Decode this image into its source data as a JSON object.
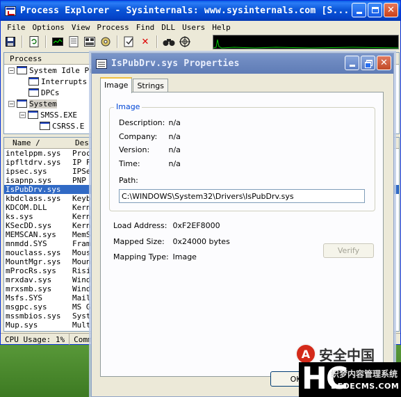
{
  "main_window": {
    "title": "Process Explorer - Sysinternals: www.sysinternals.com [S...",
    "menu": [
      "File",
      "Options",
      "View",
      "Process",
      "Find",
      "DLL",
      "Users",
      "Help"
    ],
    "toolbar_icons": [
      "save-icon",
      "refresh-icon",
      "system-info-icon",
      "properties-icon",
      "dll-view-icon",
      "gear-icon",
      "check-icon",
      "kill-icon",
      "find-icon",
      "target-icon"
    ],
    "tree_header": "Process",
    "tree_rows": [
      {
        "name": "System Idle Pro",
        "expander": "−",
        "indent": 0
      },
      {
        "name": "Interrupts",
        "expander": "",
        "indent": 1
      },
      {
        "name": "DPCs",
        "expander": "",
        "indent": 1
      },
      {
        "name": "System",
        "expander": "−",
        "indent": 0
      },
      {
        "name": "SMSS.EXE",
        "expander": "−",
        "indent": 1
      },
      {
        "name": "CSRSS.E",
        "expander": "",
        "indent": 2
      }
    ],
    "dll_headers": {
      "name": "Name  /",
      "description": "Des"
    },
    "dll_rows": [
      {
        "name": "intelppm.sys",
        "desc": "Proc"
      },
      {
        "name": "ipfltdrv.sys",
        "desc": "IP F"
      },
      {
        "name": "ipsec.sys",
        "desc": "IPSe"
      },
      {
        "name": "isapnp.sys",
        "desc": "PNP"
      },
      {
        "name": "IsPubDrv.sys",
        "desc": "",
        "selected": true
      },
      {
        "name": "kbdclass.sys",
        "desc": "Keyb"
      },
      {
        "name": "KDCOM.DLL",
        "desc": "Kern"
      },
      {
        "name": "ks.sys",
        "desc": "Kern"
      },
      {
        "name": "KSecDD.sys",
        "desc": "Kern"
      },
      {
        "name": "MEMSCAN.sys",
        "desc": "MemS"
      },
      {
        "name": "mnmdd.SYS",
        "desc": "Fram"
      },
      {
        "name": "mouclass.sys",
        "desc": "Mous"
      },
      {
        "name": "MountMgr.sys",
        "desc": "Moun"
      },
      {
        "name": "mProcRs.sys",
        "desc": "Risi"
      },
      {
        "name": "mrxdav.sys",
        "desc": "Wind"
      },
      {
        "name": "mrxsmb.sys",
        "desc": "Wind"
      },
      {
        "name": "Msfs.SYS",
        "desc": "Mail"
      },
      {
        "name": "msgpc.sys",
        "desc": "MS G"
      },
      {
        "name": "mssmbios.sys",
        "desc": "Syst"
      },
      {
        "name": "Mup.sys",
        "desc": "Mult"
      }
    ],
    "status": {
      "cpu": "CPU Usage: 1%",
      "commit": "Commi"
    }
  },
  "properties_dialog": {
    "title": "IsPubDrv.sys Properties",
    "tabs": [
      "Image",
      "Strings"
    ],
    "image_group": {
      "legend": "Image",
      "description_label": "Description:",
      "description_value": "n/a",
      "company_label": "Company:",
      "company_value": "n/a",
      "version_label": "Version:",
      "version_value": "n/a",
      "time_label": "Time:",
      "time_value": "n/a",
      "path_label": "Path:",
      "path_value": "C:\\WINDOWS\\System32\\Drivers\\IsPubDrv.sys"
    },
    "load_address_label": "Load Address:",
    "load_address_value": "0xF2EF8000",
    "mapped_size_label": "Mapped Size:",
    "mapped_size_value": "0x24000 bytes",
    "mapping_type_label": "Mapping Type:",
    "mapping_type_value": "Image",
    "verify_label": "Verify",
    "ok_label": "OK"
  },
  "watermark": {
    "chinese_text": "安全中国",
    "logo_letters": "HC",
    "cms_text": "织梦内容管理系统",
    "url": "DEDECMS.COM"
  }
}
